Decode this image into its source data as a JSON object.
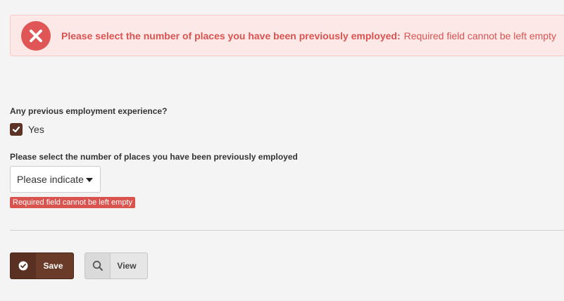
{
  "alert": {
    "title": "Please select the number of places you have been previously employed:",
    "message": "Required field cannot be left empty"
  },
  "form": {
    "experience_label": "Any previous employment experience?",
    "experience_option": "Yes",
    "experience_checked": true,
    "places_label": "Please select the number of places you have been previously employed",
    "places_value": "Please indicate",
    "places_error": "Required field cannot be left empty"
  },
  "actions": {
    "save_label": "Save",
    "view_label": "View"
  },
  "colors": {
    "error": "#d9534f",
    "alert_bg": "#fde8e8",
    "brand": "#6b3b2a"
  },
  "icons": {
    "alert": "error-x-icon",
    "checkbox": "check-icon",
    "select": "caret-down-icon",
    "save": "check-circle-icon",
    "view": "magnifier-icon"
  }
}
